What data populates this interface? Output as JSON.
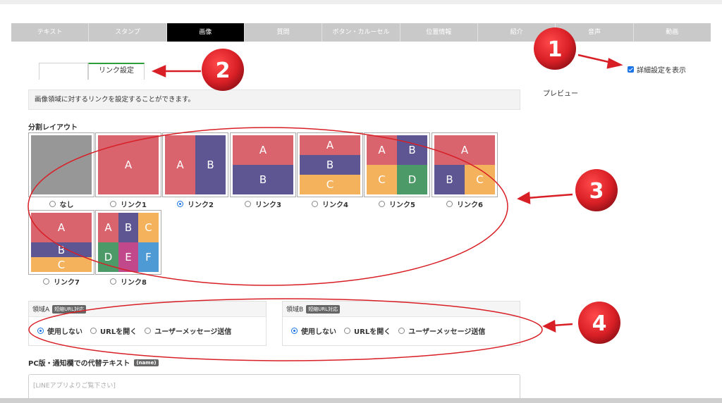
{
  "tabs": [
    "テキスト",
    "スタンプ",
    "画像",
    "質問",
    "ボタン・カルーセル",
    "位置情報",
    "紹介",
    "音声",
    "動画"
  ],
  "active_tab": "画像",
  "subtab": {
    "label": "リンク設定"
  },
  "detail": {
    "label": "詳細設定を表示"
  },
  "preview": {
    "label": "プレビュー"
  },
  "description": "画像領域に対するリンクを設定することができます。",
  "layout": {
    "title": "分割レイアウト",
    "options": [
      {
        "label": "なし",
        "selected": false
      },
      {
        "label": "リンク1",
        "selected": false
      },
      {
        "label": "リンク2",
        "selected": true
      },
      {
        "label": "リンク3",
        "selected": false
      },
      {
        "label": "リンク4",
        "selected": false
      },
      {
        "label": "リンク5",
        "selected": false
      },
      {
        "label": "リンク6",
        "selected": false
      },
      {
        "label": "リンク7",
        "selected": false
      },
      {
        "label": "リンク8",
        "selected": false
      }
    ]
  },
  "colors": {
    "red": "#d9646d",
    "purple": "#5d5693",
    "orange": "#f5b25c",
    "green": "#4c9a67",
    "pink": "#c2488c",
    "blue": "#4d9ad4",
    "gray": "#979797",
    "annotation": "#d81f26"
  },
  "regions": [
    {
      "title": "領域A",
      "badge": "短縮URL対応",
      "options": [
        "使用しない",
        "URLを開く",
        "ユーザーメッセージ送信"
      ],
      "selected": 0
    },
    {
      "title": "領域B",
      "badge": "短縮URL対応",
      "options": [
        "使用しない",
        "URLを開く",
        "ユーザーメッセージ送信"
      ],
      "selected": 0
    }
  ],
  "alt_text": {
    "title": "PC版・通知欄での代替テキスト",
    "badge": "(name)",
    "placeholder": "[LINEアプリよりご覧下さい]"
  },
  "annotations": [
    "1",
    "2",
    "3",
    "4"
  ]
}
